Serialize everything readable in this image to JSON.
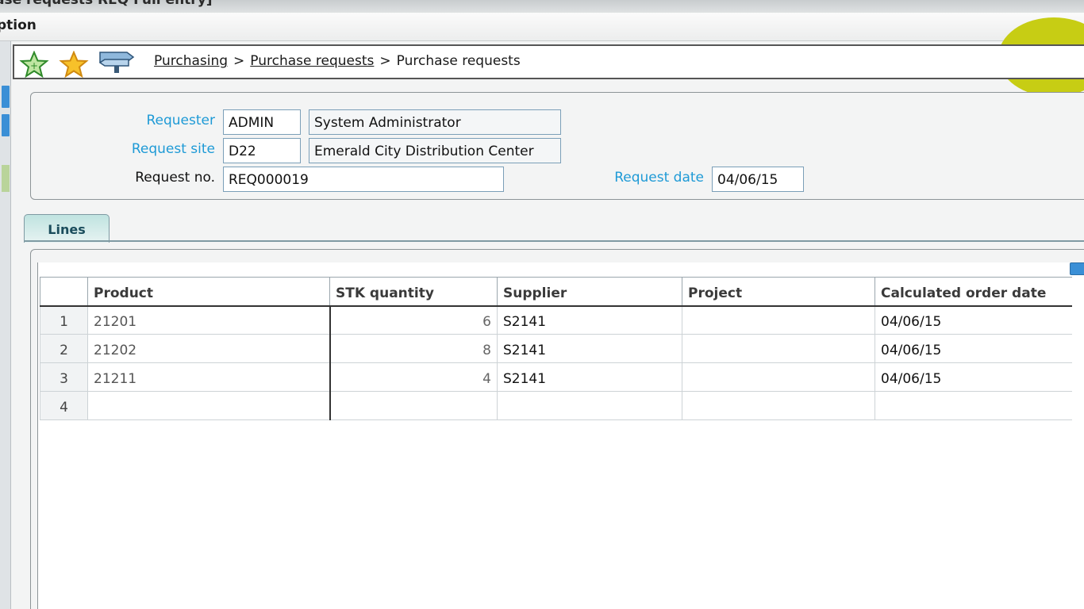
{
  "window": {
    "title_fragment": "ase requests REQ Full entry]",
    "menu_option": "ption"
  },
  "breadcrumb": {
    "items": [
      "Purchasing",
      "Purchase requests"
    ],
    "current": "Purchase requests",
    "separator": ">"
  },
  "header": {
    "requester": {
      "label": "Requester",
      "code": "ADMIN",
      "name": "System Administrator"
    },
    "request_site": {
      "label": "Request site",
      "code": "D22",
      "name": "Emerald City Distribution Center"
    },
    "request_no": {
      "label": "Request no.",
      "value": "REQ000019"
    },
    "request_date": {
      "label": "Request date",
      "value": "04/06/15"
    }
  },
  "tabs": {
    "lines": "Lines"
  },
  "grid": {
    "columns": [
      "Product",
      "STK quantity",
      "Supplier",
      "Project",
      "Calculated order date"
    ],
    "rows": [
      {
        "n": "1",
        "product": "21201",
        "qty": "6",
        "supplier": "S2141",
        "project": "",
        "order_date": "04/06/15"
      },
      {
        "n": "2",
        "product": "21202",
        "qty": "8",
        "supplier": "S2141",
        "project": "",
        "order_date": "04/06/15"
      },
      {
        "n": "3",
        "product": "21211",
        "qty": "4",
        "supplier": "S2141",
        "project": "",
        "order_date": "04/06/15"
      },
      {
        "n": "4",
        "product": "",
        "qty": "",
        "supplier": "",
        "project": "",
        "order_date": ""
      }
    ]
  },
  "icons": {
    "add_favorite": "star-add-icon",
    "favorite": "star-icon",
    "navigation": "signpost-icon",
    "grid_resize": "grid-resize-icon"
  },
  "colors": {
    "link_label": "#1e9ad6",
    "brand_blob": "#c7cd14",
    "tab_bg": "#bfe3e0"
  }
}
